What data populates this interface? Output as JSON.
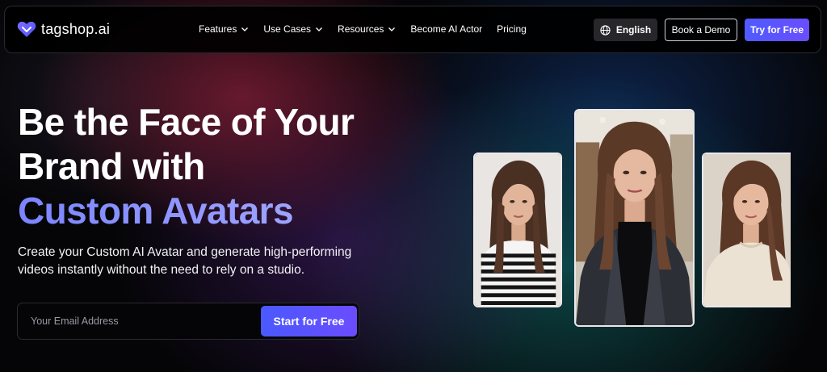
{
  "brand": {
    "name": "tagshop.ai",
    "logo_icon": "heart-logo-icon",
    "accent": "#5b5bff"
  },
  "nav": {
    "items": [
      {
        "label": "Features",
        "has_dropdown": true
      },
      {
        "label": "Use Cases",
        "has_dropdown": true
      },
      {
        "label": "Resources",
        "has_dropdown": true
      },
      {
        "label": "Become AI Actor",
        "has_dropdown": false
      },
      {
        "label": "Pricing",
        "has_dropdown": false
      }
    ],
    "language": {
      "label": "English",
      "icon": "globe-icon"
    },
    "demo_label": "Book a Demo",
    "try_label": "Try for Free"
  },
  "hero": {
    "title_line1": "Be the Face of Your",
    "title_line2": "Brand with",
    "title_accent": "Custom Avatars",
    "subtitle": "Create your Custom AI Avatar and generate high-performing videos instantly without the need to rely on a studio.",
    "email_placeholder": "Your Email Address",
    "cta_label": "Start for Free"
  },
  "avatars": [
    {
      "name": "avatar-card-left",
      "outfit": "striped-top"
    },
    {
      "name": "avatar-card-center",
      "outfit": "black-blazer"
    },
    {
      "name": "avatar-card-right",
      "outfit": "cream-sweater"
    }
  ],
  "colors": {
    "button_gradient_start": "#4a59ff",
    "button_gradient_end": "#6b4cff",
    "accent_text": "#7b84ff",
    "background": "#050507"
  }
}
